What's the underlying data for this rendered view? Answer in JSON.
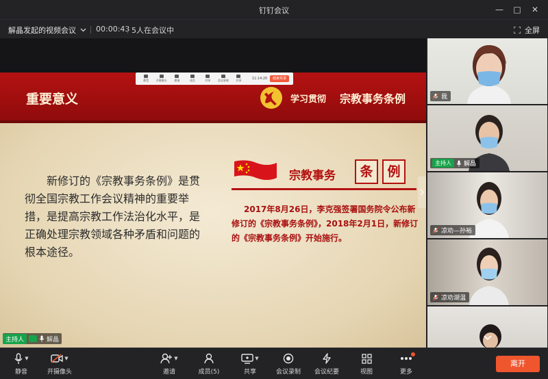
{
  "window": {
    "title": "钉钉会议",
    "minimize": "—",
    "maximize": "□",
    "close": "✕"
  },
  "infobar": {
    "meeting_name": "解晶发起的视频会议",
    "duration": "00:00:43",
    "participants_in_meeting": "5人在会议中",
    "fullscreen_label": "全屏"
  },
  "slide": {
    "header_title": "重要意义",
    "header_sub1": "学习贯彻",
    "header_sub2": "宗教事务条例",
    "body_text": "新修订的《宗教事务条例》是贯彻全国宗教工作会议精神的重要举措，是提高宗教工作法治化水平，是正确处理宗教领域各种矛盾和问题的根本途径。",
    "right_title": "宗教事务",
    "char1": "条",
    "char2": "例",
    "right_text": "2017年8月26日，李克强签署国务院令公布新修订的《宗教事务条例》，2018年2月1日，新修订的《宗教事务条例》开始施行。"
  },
  "share_toolbar": {
    "items": [
      "静音",
      "开摄像头",
      "邀请",
      "成员",
      "共享",
      "会议录制",
      "共享"
    ],
    "time": "11:14:20",
    "stop": "结束共享"
  },
  "stage_host": {
    "role": "主持人",
    "name": "解晶"
  },
  "tiles": [
    {
      "name": "我",
      "role": ""
    },
    {
      "name": "解晶",
      "role": "主持人"
    },
    {
      "name": "凉劝—孙裕",
      "role": ""
    },
    {
      "name": "凉劝湖温",
      "role": ""
    },
    {
      "name": "",
      "role": ""
    }
  ],
  "toolbar": {
    "mute": "静音",
    "camera": "开摄像头",
    "invite": "邀请",
    "members": "成员(5)",
    "share": "共享",
    "record": "会议录制",
    "minutes": "会议纪要",
    "view": "视图",
    "more": "更多",
    "leave": "离开"
  },
  "colors": {
    "accent": "#f0562e",
    "host_green": "#17a34a",
    "slide_red": "#b31010"
  }
}
